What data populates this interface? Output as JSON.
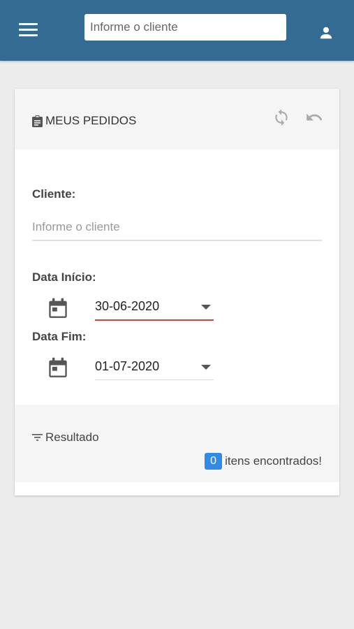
{
  "header": {
    "search_placeholder": "Informe o cliente",
    "icons": [
      "menu-icon",
      "user-icon"
    ],
    "bg_color": "#336b93"
  },
  "card": {
    "title": "MEUS PEDIDOS",
    "icons": [
      "clipboard-icon",
      "refresh-icon",
      "undo-icon"
    ],
    "cliente_label": "Cliente:",
    "cliente_placeholder": "Informe o cliente",
    "data_inicio_label": "Data Início:",
    "data_inicio_value": "30-06-2020",
    "data_fim_label": "Data Fim:",
    "data_fim_value": "01-07-2020"
  },
  "result": {
    "title": "Resultado",
    "count": "0",
    "count_text": "itens encontrados!",
    "badge_color": "#2f8be6"
  }
}
